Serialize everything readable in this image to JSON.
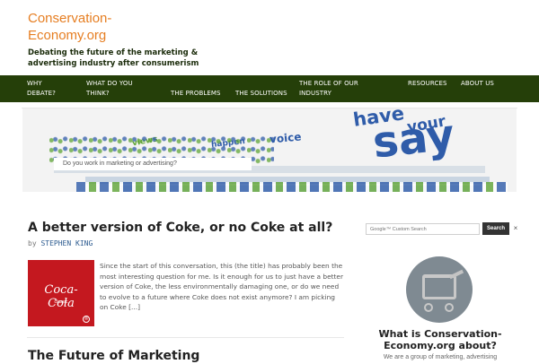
{
  "site": {
    "title": "Conservation-Economy.org",
    "tagline": "Debating the future of the marketing & advertising industry after consumerism"
  },
  "nav": {
    "items": [
      {
        "label": "WHY DEBATE?"
      },
      {
        "label": "WHAT DO YOU THINK?"
      },
      {
        "label": "THE PROBLEMS"
      },
      {
        "label": "THE SOLUTIONS"
      },
      {
        "label": "THE ROLE OF OUR INDUSTRY"
      },
      {
        "label": "RESOURCES"
      },
      {
        "label": "ABOUT US"
      }
    ]
  },
  "hero": {
    "caption": "Do you work in marketing or advertising?",
    "words": [
      "have",
      "your",
      "voice",
      "say",
      "views",
      "happen"
    ]
  },
  "post": {
    "title": "A better version of Coke, or no Coke at all?",
    "byline_prefix": "by",
    "author": "STEPHEN KING",
    "image_text": "Coca-Cola",
    "image_subtext": "classic",
    "image_mark": "®",
    "excerpt": "Since the start of this conversation, this (the title) has probably been the most interesting question for me. Is it enough for us to just have a better version of Coke, the less environmentally damaging one, or do we need to evolve to a future where Coke does not exist anymore? I am picking on Coke [...]"
  },
  "next_post": {
    "title": "The Future of Marketing"
  },
  "sidebar": {
    "search_placeholder": "Google™ Custom Search",
    "search_button": "Search",
    "clear_label": "×",
    "widget_title": "What is Conservation-Economy.org about?",
    "widget_text": "We are a group of marketing, advertising"
  },
  "colors": {
    "accent": "#e67e22",
    "nav_bg": "#253f09",
    "hero_blue": "#2f5ca9",
    "hero_green": "#5fa536"
  }
}
